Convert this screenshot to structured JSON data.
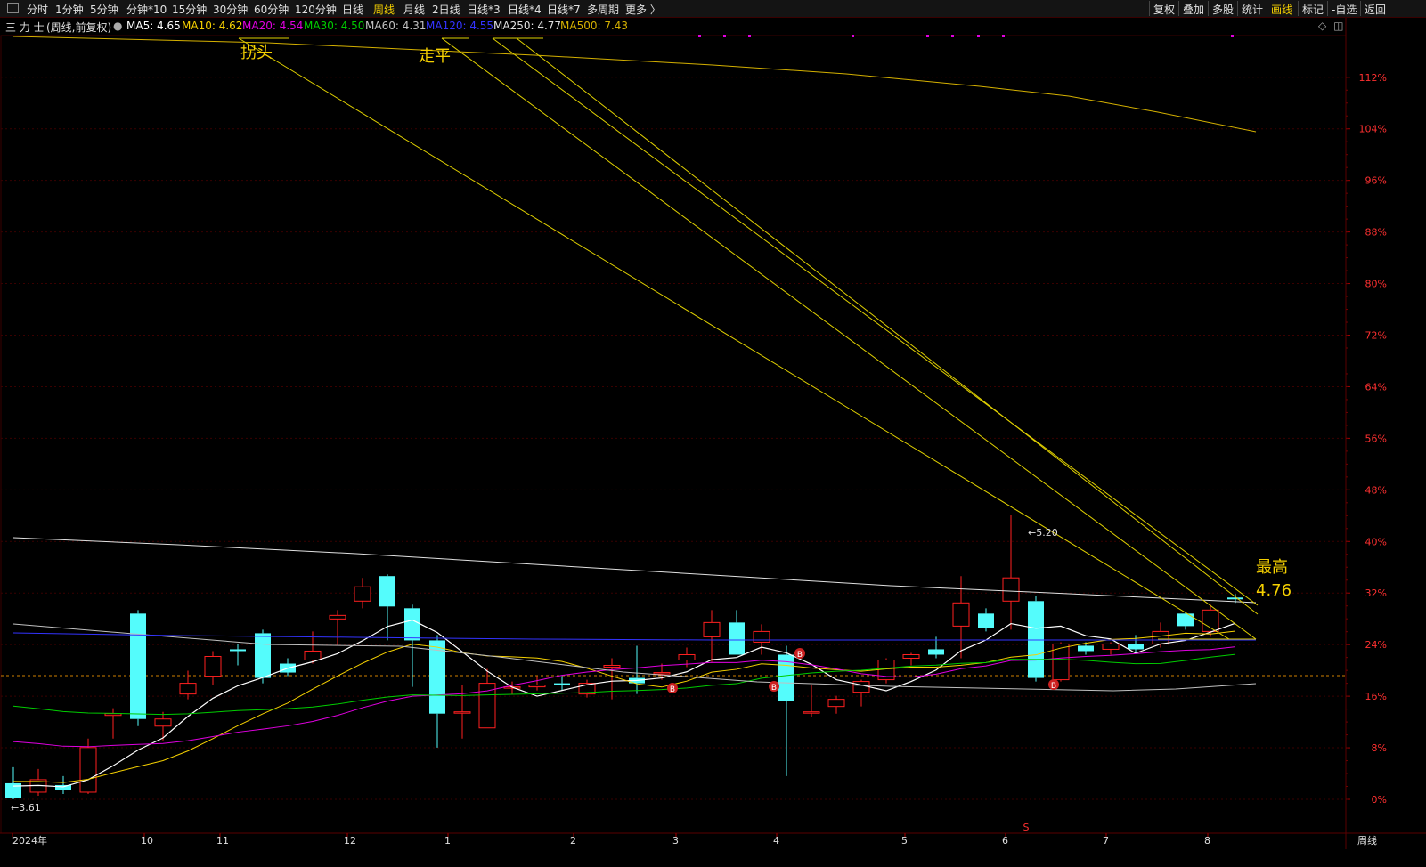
{
  "toolbar": {
    "periods": [
      "分时",
      "1分钟",
      "5分钟",
      "分钟*10",
      "15分钟",
      "30分钟",
      "60分钟",
      "120分钟",
      "日线",
      "周线",
      "月线",
      "2日线",
      "日线*3",
      "日线*4",
      "日线*7",
      "多周期",
      "更多 〉"
    ],
    "active_period": "周线",
    "right_buttons": [
      "复权",
      "叠加",
      "多股",
      "统计",
      "画线",
      "标记",
      "-自选",
      "返回"
    ],
    "active_right": "画线"
  },
  "info": {
    "stock_name": "三 力 士",
    "mode": "(周线,前复权)",
    "ma5": "MA5: 4.65",
    "ma10": "MA10: 4.62",
    "ma20": "MA20: 4.54",
    "ma30": "MA30: 4.50",
    "ma60": "MA60: 4.31",
    "ma120": "MA120: 4.55",
    "ma250": "MA250: 4.77",
    "ma500": "MA500: 7.43"
  },
  "colors": {
    "ma5": "#ffffff",
    "ma10": "#f5d000",
    "ma20": "#e000e0",
    "ma30": "#00cc00",
    "ma60": "#c0c0c0",
    "ma120": "#3333ff",
    "ma250": "#e0e0e0",
    "ma500": "#d4b000",
    "up": "#ff2020",
    "down": "#54fcfc",
    "grid": "#3a0000",
    "axis_label": "#ff3030"
  },
  "annotations": {
    "label1": "拐头",
    "label2": "走平",
    "high_title": "最高",
    "high_value": "4.76",
    "low_marker": "←3.61",
    "peak_marker": "←5.20",
    "signal": "B",
    "s_marker": "S"
  },
  "y_axis": {
    "labels": [
      "112%",
      "104%",
      "96%",
      "88%",
      "80%",
      "72%",
      "64%",
      "56%",
      "48%",
      "40%",
      "32%",
      "24%",
      "16%",
      "8%",
      "0%"
    ]
  },
  "x_axis": {
    "labels": [
      "2024年",
      "10",
      "11",
      "12",
      "1",
      "2",
      "3",
      "4",
      "5",
      "6",
      "7",
      "8"
    ],
    "period_label": "周线"
  },
  "chart_data": {
    "type": "candlestick",
    "low_price": 3.61,
    "high_price_marker": 5.2,
    "latest_high": 4.76,
    "candles": [
      {
        "o": 3.7,
        "c": 3.62,
        "h": 3.79,
        "l": 3.61
      },
      {
        "o": 3.65,
        "c": 3.72,
        "h": 3.78,
        "l": 3.63
      },
      {
        "o": 3.69,
        "c": 3.66,
        "h": 3.74,
        "l": 3.64
      },
      {
        "o": 3.65,
        "c": 3.9,
        "h": 3.95,
        "l": 3.64
      },
      {
        "o": 4.08,
        "c": 4.09,
        "h": 4.12,
        "l": 3.95
      },
      {
        "o": 4.65,
        "c": 4.06,
        "h": 4.67,
        "l": 4.02
      },
      {
        "o": 4.02,
        "c": 4.06,
        "h": 4.1,
        "l": 3.94
      },
      {
        "o": 4.2,
        "c": 4.26,
        "h": 4.33,
        "l": 4.17
      },
      {
        "o": 4.3,
        "c": 4.41,
        "h": 4.44,
        "l": 4.25
      },
      {
        "o": 4.45,
        "c": 4.44,
        "h": 4.48,
        "l": 4.36
      },
      {
        "o": 4.54,
        "c": 4.29,
        "h": 4.56,
        "l": 4.26
      },
      {
        "o": 4.37,
        "c": 4.32,
        "h": 4.4,
        "l": 4.3
      },
      {
        "o": 4.39,
        "c": 4.44,
        "h": 4.55,
        "l": 4.37
      },
      {
        "o": 4.62,
        "c": 4.64,
        "h": 4.67,
        "l": 4.47
      },
      {
        "o": 4.72,
        "c": 4.8,
        "h": 4.85,
        "l": 4.68
      },
      {
        "o": 4.86,
        "c": 4.69,
        "h": 4.87,
        "l": 4.5
      },
      {
        "o": 4.68,
        "c": 4.5,
        "h": 4.7,
        "l": 4.24
      },
      {
        "o": 4.5,
        "c": 4.09,
        "h": 4.53,
        "l": 3.9
      },
      {
        "o": 4.1,
        "c": 4.1,
        "h": 4.25,
        "l": 3.95
      },
      {
        "o": 4.01,
        "c": 4.26,
        "h": 4.34,
        "l": 4.01
      },
      {
        "o": 4.24,
        "c": 4.24,
        "h": 4.27,
        "l": 4.2
      },
      {
        "o": 4.24,
        "c": 4.25,
        "h": 4.3,
        "l": 4.22
      },
      {
        "o": 4.26,
        "c": 4.25,
        "h": 4.3,
        "l": 4.22
      },
      {
        "o": 4.2,
        "c": 4.26,
        "h": 4.28,
        "l": 4.18
      },
      {
        "o": 4.35,
        "c": 4.36,
        "h": 4.4,
        "l": 4.17
      },
      {
        "o": 4.29,
        "c": 4.26,
        "h": 4.47,
        "l": 4.2
      },
      {
        "o": 4.32,
        "c": 4.32,
        "h": 4.37,
        "l": 4.28
      },
      {
        "o": 4.39,
        "c": 4.42,
        "h": 4.46,
        "l": 4.35
      },
      {
        "o": 4.52,
        "c": 4.6,
        "h": 4.67,
        "l": 4.38
      },
      {
        "o": 4.6,
        "c": 4.42,
        "h": 4.67,
        "l": 4.42
      },
      {
        "o": 4.49,
        "c": 4.55,
        "h": 4.59,
        "l": 4.42
      },
      {
        "o": 4.42,
        "c": 4.16,
        "h": 4.47,
        "l": 3.74
      },
      {
        "o": 4.1,
        "c": 4.1,
        "h": 4.25,
        "l": 4.07
      },
      {
        "o": 4.13,
        "c": 4.17,
        "h": 4.19,
        "l": 4.09
      },
      {
        "o": 4.21,
        "c": 4.27,
        "h": 4.28,
        "l": 4.13
      },
      {
        "o": 4.28,
        "c": 4.39,
        "h": 4.4,
        "l": 4.26
      },
      {
        "o": 4.4,
        "c": 4.42,
        "h": 4.43,
        "l": 4.36
      },
      {
        "o": 4.45,
        "c": 4.42,
        "h": 4.52,
        "l": 4.4
      },
      {
        "o": 4.58,
        "c": 4.71,
        "h": 4.86,
        "l": 4.4
      },
      {
        "o": 4.65,
        "c": 4.57,
        "h": 4.68,
        "l": 4.55
      },
      {
        "o": 4.72,
        "c": 4.85,
        "h": 5.2,
        "l": 4.56
      },
      {
        "o": 4.72,
        "c": 4.29,
        "h": 4.75,
        "l": 4.27
      },
      {
        "o": 4.28,
        "c": 4.48,
        "h": 4.49,
        "l": 4.27
      },
      {
        "o": 4.47,
        "c": 4.44,
        "h": 4.49,
        "l": 4.42
      },
      {
        "o": 4.45,
        "c": 4.48,
        "h": 4.49,
        "l": 4.42
      },
      {
        "o": 4.48,
        "c": 4.45,
        "h": 4.53,
        "l": 4.43
      },
      {
        "o": 4.48,
        "c": 4.55,
        "h": 4.6,
        "l": 4.46
      },
      {
        "o": 4.65,
        "c": 4.58,
        "h": 4.66,
        "l": 4.56
      },
      {
        "o": 4.55,
        "c": 4.67,
        "h": 4.7,
        "l": 4.52
      },
      {
        "o": 4.74,
        "c": 4.73,
        "h": 4.76,
        "l": 4.71
      }
    ]
  }
}
